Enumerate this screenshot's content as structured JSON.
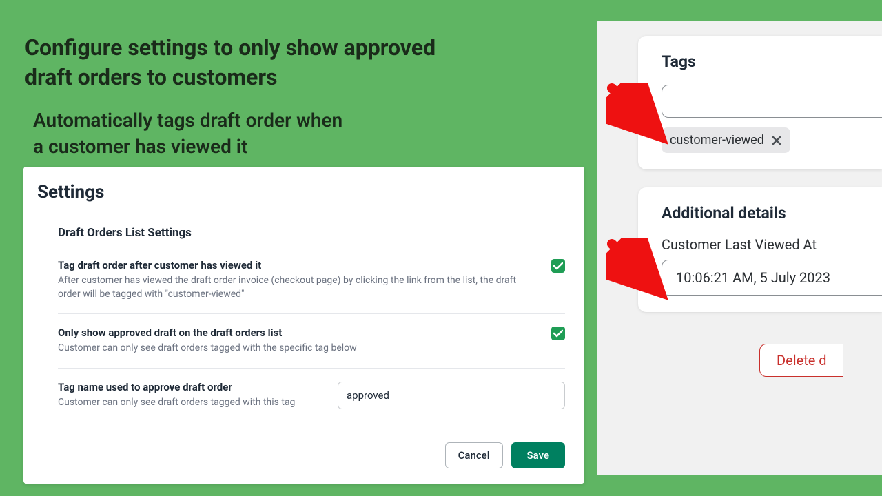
{
  "headline_line1": "Configure settings to only show approved",
  "headline_line2": "draft orders to customers",
  "subhead_line1": "Automatically tags draft order when",
  "subhead_line2": "a customer has viewed it",
  "settings": {
    "title": "Settings",
    "section": "Draft Orders List Settings",
    "items": [
      {
        "label": "Tag draft order after customer has viewed it",
        "help": "After customer has viewed the draft order invoice (checkout page) by clicking the link from the list, the draft order will be tagged with \"customer-viewed\"",
        "checked": true
      },
      {
        "label": "Only show approved draft on the draft orders list",
        "help": "Customer can only see draft orders tagged with the specific tag below",
        "checked": true
      },
      {
        "label": "Tag name used to approve draft order",
        "help": "Customer can only see draft orders tagged with this tag",
        "value": "approved"
      }
    ],
    "cancel": "Cancel",
    "save": "Save"
  },
  "tags_panel": {
    "title": "Tags",
    "chip": "customer-viewed"
  },
  "details_panel": {
    "title": "Additional details",
    "field_label": "Customer Last Viewed At",
    "field_value": "10:06:21 AM, 5 July 2023"
  },
  "delete_label": "Delete d"
}
